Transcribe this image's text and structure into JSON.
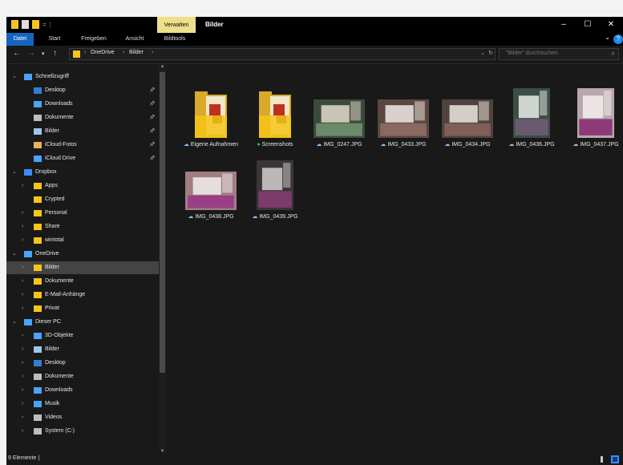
{
  "window": {
    "title": "Bilder",
    "context_tab": "Verwalten",
    "controls": [
      "–",
      "☐",
      "✕"
    ]
  },
  "ribbon": {
    "tabs": [
      "Datei",
      "Start",
      "Freigeben",
      "Ansicht",
      "Bildtools"
    ],
    "active": "Datei",
    "help": "?",
    "expand": "⌄"
  },
  "address": {
    "breadcrumb": [
      "OneDrive",
      "Bilder"
    ],
    "search_placeholder": "\"Bilder\" durchsuchen"
  },
  "nav_tree": [
    {
      "label": "Schnellzugriff",
      "level": 0,
      "icon": "star-icon",
      "color": "#4aa3ff",
      "expanded": true
    },
    {
      "label": "Desktop",
      "level": 1,
      "icon": "desktop-icon",
      "color": "#2e7fd6",
      "pinned": true
    },
    {
      "label": "Downloads",
      "level": 1,
      "icon": "download-icon",
      "color": "#4aa3ff",
      "pinned": true
    },
    {
      "label": "Dokumente",
      "level": 1,
      "icon": "document-icon",
      "color": "#bdbdbd",
      "pinned": true
    },
    {
      "label": "Bilder",
      "level": 1,
      "icon": "pictures-icon",
      "color": "#9fc6e8",
      "pinned": true
    },
    {
      "label": "iCloud-Fotos",
      "level": 1,
      "icon": "icloud-photos-icon",
      "color": "#e8b15a",
      "pinned": true
    },
    {
      "label": "iCloud Drive",
      "level": 1,
      "icon": "icloud-drive-icon",
      "color": "#4aa3ff",
      "pinned": true
    },
    {
      "label": "Dropbox",
      "level": 0,
      "icon": "dropbox-icon",
      "color": "#3d8bfd",
      "expanded": true
    },
    {
      "label": "Apps",
      "level": 1,
      "icon": "folder-icon",
      "color": "#f5c518",
      "collapsed": true
    },
    {
      "label": "Crypted",
      "level": 1,
      "icon": "folder-icon",
      "color": "#f5c518"
    },
    {
      "label": "Personal",
      "level": 1,
      "icon": "folder-icon",
      "color": "#f5c518",
      "collapsed": true
    },
    {
      "label": "Share",
      "level": 1,
      "icon": "folder-icon",
      "color": "#f5c518",
      "collapsed": true
    },
    {
      "label": "wintotal",
      "level": 1,
      "icon": "folder-icon",
      "color": "#f5c518",
      "collapsed": true
    },
    {
      "label": "OneDrive",
      "level": 0,
      "icon": "onedrive-icon",
      "color": "#4aa3ff",
      "expanded": true
    },
    {
      "label": "Bilder",
      "level": 1,
      "icon": "folder-icon",
      "color": "#f5c518",
      "collapsed": true,
      "selected": true
    },
    {
      "label": "Dokumente",
      "level": 1,
      "icon": "folder-icon",
      "color": "#f5c518",
      "collapsed": true
    },
    {
      "label": "E-Mail-Anhänge",
      "level": 1,
      "icon": "folder-icon",
      "color": "#f5c518",
      "collapsed": true
    },
    {
      "label": "Privat",
      "level": 1,
      "icon": "folder-icon",
      "color": "#f5c518",
      "collapsed": true
    },
    {
      "label": "Dieser PC",
      "level": 0,
      "icon": "this-pc-icon",
      "color": "#4aa3ff",
      "expanded": true
    },
    {
      "label": "3D-Objekte",
      "level": 1,
      "icon": "3d-objects-icon",
      "color": "#4aa3ff",
      "collapsed": true
    },
    {
      "label": "Bilder",
      "level": 1,
      "icon": "pictures-icon",
      "color": "#9fc6e8",
      "collapsed": true
    },
    {
      "label": "Desktop",
      "level": 1,
      "icon": "desktop-icon",
      "color": "#2e7fd6",
      "collapsed": true
    },
    {
      "label": "Dokumente",
      "level": 1,
      "icon": "document-icon",
      "color": "#bdbdbd",
      "collapsed": true
    },
    {
      "label": "Downloads",
      "level": 1,
      "icon": "download-icon",
      "color": "#4aa3ff",
      "collapsed": true
    },
    {
      "label": "Musik",
      "level": 1,
      "icon": "music-icon",
      "color": "#4aa3ff",
      "collapsed": true
    },
    {
      "label": "Videos",
      "level": 1,
      "icon": "videos-icon",
      "color": "#bdbdbd",
      "collapsed": true
    },
    {
      "label": "System (C:)",
      "level": 1,
      "icon": "drive-icon",
      "color": "#bdbdbd",
      "collapsed": true
    }
  ],
  "files": [
    {
      "name": "Eigene Aufnahmen",
      "kind": "folder",
      "status": "cloud"
    },
    {
      "name": "Screenshots",
      "kind": "folder",
      "status": "synced"
    },
    {
      "name": "IMG_0247.JPG",
      "kind": "image",
      "status": "cloud",
      "orient": "landscape",
      "palette": [
        "#3b4a3c",
        "#c9c4b5",
        "#6b8a6a"
      ]
    },
    {
      "name": "IMG_0433.JPG",
      "kind": "image",
      "status": "cloud",
      "orient": "landscape",
      "palette": [
        "#5a4840",
        "#d9d2cc",
        "#8a6a60"
      ]
    },
    {
      "name": "IMG_0434.JPG",
      "kind": "image",
      "status": "cloud",
      "orient": "landscape",
      "palette": [
        "#50423c",
        "#d5cec7",
        "#7f5f58"
      ]
    },
    {
      "name": "IMG_0436.JPG",
      "kind": "image",
      "status": "cloud",
      "orient": "portrait",
      "palette": [
        "#3c4d44",
        "#cfd6d2",
        "#6a5a70"
      ]
    },
    {
      "name": "IMG_0437.JPG",
      "kind": "image",
      "status": "cloud",
      "orient": "portrait",
      "palette": [
        "#b8a8ad",
        "#ece4e4",
        "#8e3a78"
      ]
    },
    {
      "name": "IMG_0438.JPG",
      "kind": "image",
      "status": "cloud",
      "orient": "landscape",
      "palette": [
        "#a07e82",
        "#e6dede",
        "#9a3f85"
      ]
    },
    {
      "name": "IMG_0439.JPG",
      "kind": "image",
      "status": "cloud",
      "orient": "portrait",
      "palette": [
        "#3a3638",
        "#bcb6b6",
        "#7d3a6d"
      ]
    }
  ],
  "status": {
    "count_text": "9 Elemente  |"
  }
}
